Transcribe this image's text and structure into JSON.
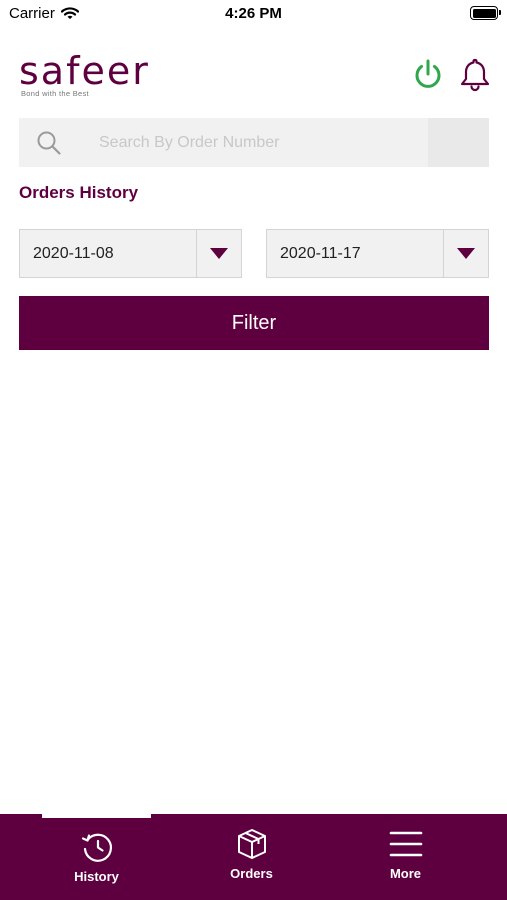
{
  "status_bar": {
    "carrier": "Carrier",
    "time": "4:26 PM"
  },
  "header": {
    "logo_text": "safeer",
    "logo_tagline": "Bond with the Best",
    "power_icon": "power-icon",
    "bell_icon": "bell-icon"
  },
  "search": {
    "placeholder": "Search By Order Number",
    "value": ""
  },
  "section_title": "Orders History",
  "filters": {
    "from_date": "2020-11-08",
    "to_date": "2020-11-17",
    "button_label": "Filter"
  },
  "tabs": [
    {
      "label": "History",
      "icon": "history-icon"
    },
    {
      "label": "Orders",
      "icon": "box-icon"
    },
    {
      "label": "More",
      "icon": "menu-icon"
    }
  ],
  "colors": {
    "brand": "#5e003f",
    "power": "#2ea84a",
    "field_bg": "#f1f1f1"
  }
}
